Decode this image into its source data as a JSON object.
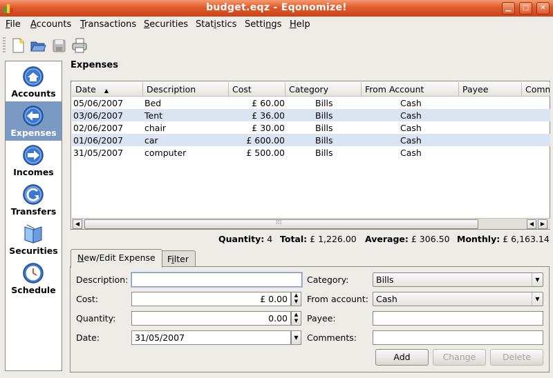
{
  "window": {
    "title": "budget.eqz - Eqonomize!"
  },
  "menu": [
    {
      "label": "File",
      "ul": "F",
      "rest": "ile"
    },
    {
      "label": "Accounts",
      "ul": "A",
      "rest": "ccounts"
    },
    {
      "label": "Transactions",
      "ul": "T",
      "rest": "ransactions"
    },
    {
      "label": "Securities",
      "ul": "S",
      "rest": "ecurities"
    },
    {
      "label": "Statistics",
      "pre": "Stat",
      "ul": "i",
      "rest": "stics"
    },
    {
      "label": "Settings",
      "pre": "Setti",
      "ul": "n",
      "rest": "gs"
    },
    {
      "label": "Help",
      "ul": "H",
      "rest": "elp"
    }
  ],
  "toolbar": [
    "new-file-icon",
    "open-folder-icon",
    "save-icon",
    "print-icon"
  ],
  "sidebar": [
    {
      "label": "Accounts",
      "icon": "home-icon"
    },
    {
      "label": "Expenses",
      "icon": "arrow-left-icon",
      "selected": true
    },
    {
      "label": "Incomes",
      "icon": "arrow-right-icon"
    },
    {
      "label": "Transfers",
      "icon": "transfer-icon"
    },
    {
      "label": "Securities",
      "icon": "book-icon"
    },
    {
      "label": "Schedule",
      "icon": "clock-icon"
    }
  ],
  "section_title": "Expenses",
  "table": {
    "columns": [
      "Date",
      "Description",
      "Cost",
      "Category",
      "From Account",
      "Payee",
      "Comm"
    ],
    "sort_indicator": "▲",
    "rows": [
      [
        "05/06/2007",
        "Bed",
        "£ 60.00",
        "Bills",
        "Cash",
        "",
        ""
      ],
      [
        "03/06/2007",
        "Tent",
        "£ 36.00",
        "Bills",
        "Cash",
        "",
        ""
      ],
      [
        "02/06/2007",
        "chair",
        "£ 30.00",
        "Bills",
        "Cash",
        "",
        ""
      ],
      [
        "01/06/2007",
        "car",
        "£ 600.00",
        "Bills",
        "Cash",
        "",
        ""
      ],
      [
        "31/05/2007",
        "computer",
        "£ 500.00",
        "Bills",
        "Cash",
        "",
        ""
      ]
    ]
  },
  "summary": {
    "quantity_label": "Quantity:",
    "quantity": "4",
    "total_label": "Total:",
    "total": "£ 1,226.00",
    "average_label": "Average:",
    "average": "£ 306.50",
    "monthly_label": "Monthly:",
    "monthly": "£ 6,163.14"
  },
  "tabs": [
    {
      "label": "New/Edit Expense",
      "ul": "N",
      "rest": "ew/Edit Expense",
      "active": true
    },
    {
      "label": "Filter",
      "pre": "F",
      "ul": "i",
      "rest": "lter"
    }
  ],
  "form": {
    "description_label": "Description:",
    "description_value": "",
    "cost_label": "Cost:",
    "cost_value": "£ 0.00",
    "quantity_label": "Quantity:",
    "quantity_value": "0.00",
    "date_label": "Date:",
    "date_value": "31/05/2007",
    "category_label": "Category:",
    "category_value": "Bills",
    "from_account_label": "From account:",
    "from_account_value": "Cash",
    "payee_label": "Payee:",
    "payee_value": "",
    "comments_label": "Comments:",
    "comments_value": ""
  },
  "buttons": {
    "add": "Add",
    "change": "Change",
    "delete": "Delete"
  },
  "colors": {
    "titlebar": "#e05c2a",
    "selection": "#7a9ac3",
    "alt_row": "#dbe4f3"
  }
}
